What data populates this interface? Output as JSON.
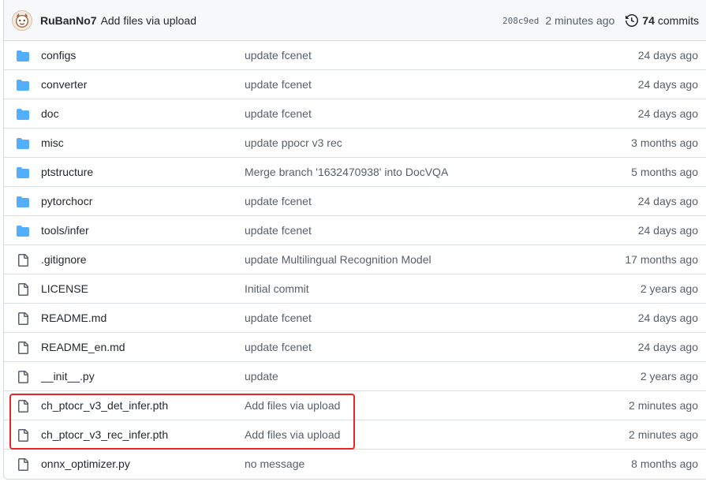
{
  "commit": {
    "author": "RuBanNo7",
    "message": "Add files via upload",
    "sha": "208c9ed",
    "time": "2 minutes ago",
    "commit_count": "74",
    "commits_label": "commits"
  },
  "colors": {
    "folder": "#54aeff",
    "file": "#57606a",
    "highlight": "#e8262a"
  },
  "files": [
    {
      "type": "folder",
      "icon": "folder-icon",
      "name": "configs",
      "message": "update fcenet",
      "age": "24 days ago"
    },
    {
      "type": "folder",
      "icon": "folder-icon",
      "name": "converter",
      "message": "update fcenet",
      "age": "24 days ago"
    },
    {
      "type": "folder",
      "icon": "folder-icon",
      "name": "doc",
      "message": "update fcenet",
      "age": "24 days ago"
    },
    {
      "type": "folder",
      "icon": "folder-icon",
      "name": "misc",
      "message": "update ppocr v3 rec",
      "age": "3 months ago"
    },
    {
      "type": "folder",
      "icon": "folder-icon",
      "name": "ptstructure",
      "message": "Merge branch '1632470938' into DocVQA",
      "age": "5 months ago"
    },
    {
      "type": "folder",
      "icon": "folder-icon",
      "name": "pytorchocr",
      "message": "update fcenet",
      "age": "24 days ago"
    },
    {
      "type": "folder",
      "icon": "folder-icon",
      "name": "tools/infer",
      "message": "update fcenet",
      "age": "24 days ago"
    },
    {
      "type": "file",
      "icon": "file-icon",
      "name": ".gitignore",
      "message": "update Multilingual Recognition Model",
      "age": "17 months ago"
    },
    {
      "type": "file",
      "icon": "file-icon",
      "name": "LICENSE",
      "message": "Initial commit",
      "age": "2 years ago"
    },
    {
      "type": "file",
      "icon": "file-icon",
      "name": "README.md",
      "message": "update fcenet",
      "age": "24 days ago"
    },
    {
      "type": "file",
      "icon": "file-icon",
      "name": "README_en.md",
      "message": "update fcenet",
      "age": "24 days ago"
    },
    {
      "type": "file",
      "icon": "file-icon",
      "name": "__init__.py",
      "message": "update",
      "age": "2 years ago"
    },
    {
      "type": "file",
      "icon": "file-icon",
      "name": "ch_ptocr_v3_det_infer.pth",
      "message": "Add files via upload",
      "age": "2 minutes ago"
    },
    {
      "type": "file",
      "icon": "file-icon",
      "name": "ch_ptocr_v3_rec_infer.pth",
      "message": "Add files via upload",
      "age": "2 minutes ago"
    },
    {
      "type": "file",
      "icon": "file-icon",
      "name": "onnx_optimizer.py",
      "message": "no message",
      "age": "8 months ago"
    }
  ]
}
